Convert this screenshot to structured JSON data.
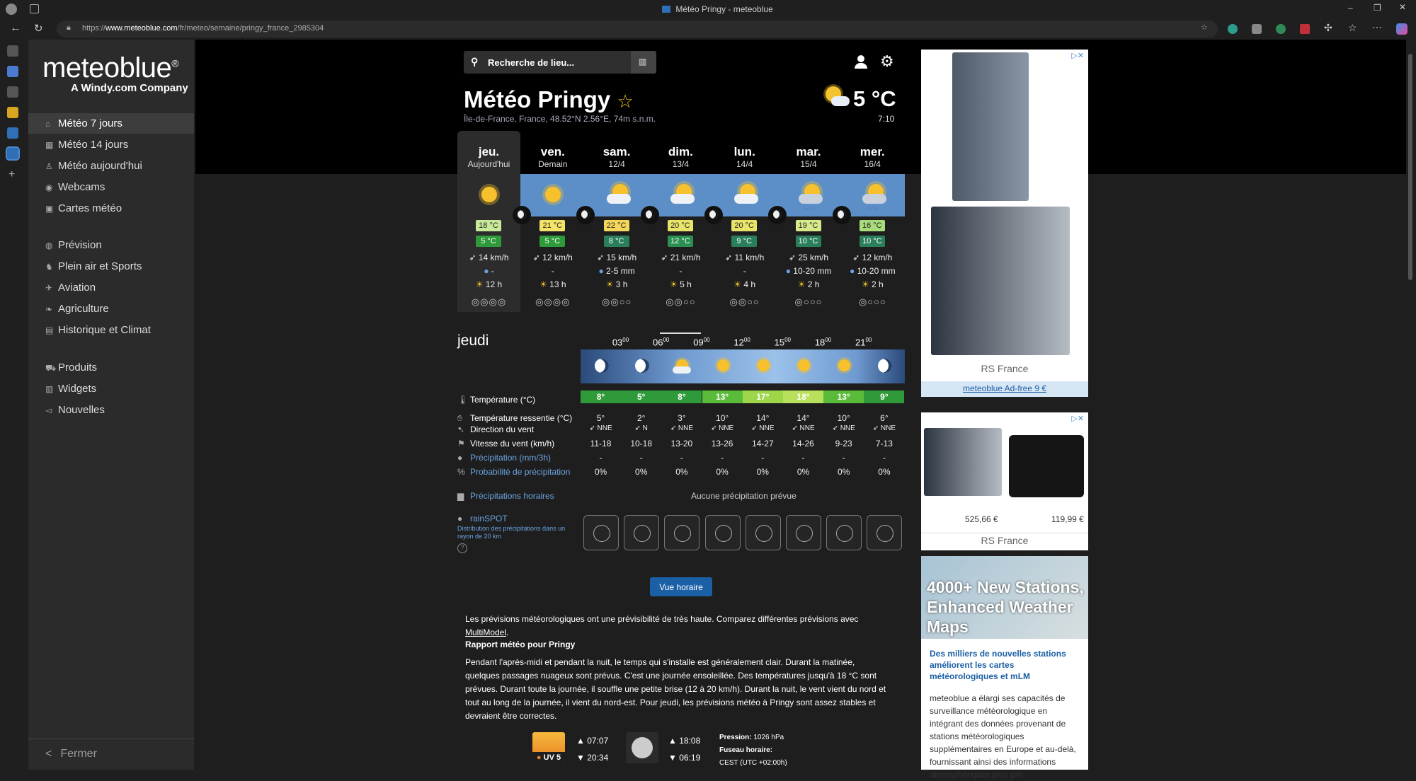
{
  "browser": {
    "tab_title": "Météo Pringy - meteoblue",
    "url_prefix": "https://",
    "url_host": "www.meteoblue.com",
    "url_path": "/fr/meteo/semaine/pringy_france_2985304"
  },
  "sidebar": {
    "logo": "meteoblue",
    "logo_sub": "A Windy.com Company",
    "items": [
      {
        "label": "Météo 7 jours",
        "icon": "home-icon"
      },
      {
        "label": "Météo 14 jours",
        "icon": "calendar-icon"
      },
      {
        "label": "Météo aujourd'hui",
        "icon": "person-icon"
      },
      {
        "label": "Webcams",
        "icon": "webcam-icon"
      },
      {
        "label": "Cartes météo",
        "icon": "map-icon"
      },
      {
        "label": "Prévision",
        "icon": "globe-icon"
      },
      {
        "label": "Plein air et Sports",
        "icon": "hiker-icon"
      },
      {
        "label": "Aviation",
        "icon": "plane-icon"
      },
      {
        "label": "Agriculture",
        "icon": "leaf-icon"
      },
      {
        "label": "Historique et Climat",
        "icon": "chart-icon"
      },
      {
        "label": "Produits",
        "icon": "cart-icon"
      },
      {
        "label": "Widgets",
        "icon": "widget-icon"
      },
      {
        "label": "Nouvelles",
        "icon": "megaphone-icon"
      }
    ],
    "close_label": "Fermer"
  },
  "search": {
    "placeholder": "Recherche de lieu..."
  },
  "header": {
    "city": "Météo Pringy",
    "coords": "Île-de-France, France, 48.52°N 2.56°E, 74m s.n.m.",
    "current_temp": "5 °C",
    "current_time": "7:10"
  },
  "days": [
    {
      "name": "jeu.",
      "date": "Aujourd'hui",
      "tmax": "18 °C",
      "tmin": "5 °C",
      "wind": "14 km/h",
      "prec": "-",
      "sun": "12 h",
      "pred": "◎◎◎◎",
      "icon": "sunny-icon",
      "tmax_color": "#c8e89a",
      "tmin_color": "#2f9a3a"
    },
    {
      "name": "ven.",
      "date": "Demain",
      "tmax": "21 °C",
      "tmin": "5 °C",
      "wind": "12 km/h",
      "prec": "-",
      "sun": "13 h",
      "pred": "◎◎◎◎",
      "icon": "sunny-icon",
      "tmax_color": "#f3e467",
      "tmin_color": "#2f9a3a"
    },
    {
      "name": "sam.",
      "date": "12/4",
      "tmax": "22 °C",
      "tmin": "8 °C",
      "wind": "15 km/h",
      "prec": "2-5 mm",
      "sun": "3 h",
      "pred": "◎◎○○",
      "icon": "partly-cloudy-icon",
      "tmax_color": "#f3d65a",
      "tmin_color": "#2a7f5a"
    },
    {
      "name": "dim.",
      "date": "13/4",
      "tmax": "20 °C",
      "tmin": "12 °C",
      "wind": "21 km/h",
      "prec": "-",
      "sun": "5 h",
      "pred": "◎◎○○",
      "icon": "partly-cloudy-icon",
      "tmax_color": "#e8e46a",
      "tmin_color": "#2a8f50"
    },
    {
      "name": "lun.",
      "date": "14/4",
      "tmax": "20 °C",
      "tmin": "9 °C",
      "wind": "11 km/h",
      "prec": "-",
      "sun": "4 h",
      "pred": "◎◎○○",
      "icon": "partly-cloudy-icon",
      "tmax_color": "#e8e46a",
      "tmin_color": "#2a7f5a"
    },
    {
      "name": "mar.",
      "date": "15/4",
      "tmax": "19 °C",
      "tmin": "10 °C",
      "wind": "25 km/h",
      "prec": "10-20 mm",
      "sun": "2 h",
      "pred": "◎○○○",
      "icon": "rain-cloud-icon",
      "tmax_color": "#d6ea8a",
      "tmin_color": "#2a7f5a"
    },
    {
      "name": "mer.",
      "date": "16/4",
      "tmax": "16 °C",
      "tmin": "10 °C",
      "wind": "12 km/h",
      "prec": "10-20 mm",
      "sun": "2 h",
      "pred": "◎○○○",
      "icon": "rain-cloud-icon",
      "tmax_color": "#a8dc7a",
      "tmin_color": "#2a7f5a"
    }
  ],
  "hourly": {
    "title": "jeudi",
    "hours": [
      "03",
      "06",
      "09",
      "12",
      "15",
      "18",
      "21"
    ],
    "labels": {
      "temp": "Température (°C)",
      "feel": "Température ressentie (°C)",
      "dir": "Direction du vent",
      "speed": "Vitesse du vent (km/h)",
      "prec": "Précipitation (mm/3h)",
      "prob": "Probabilité de précipitation",
      "hourly_prec": "Précipitations horaires",
      "rainspot": "rainSPOT",
      "rainspot_desc": "Distribution des précipitations dans un rayon de 20 km"
    },
    "temp": [
      "8°",
      "5°",
      "8°",
      "13°",
      "17°",
      "18°",
      "13°",
      "9°"
    ],
    "temp_colors": [
      "#2f9a3a",
      "#2f9a3a",
      "#2f9a3a",
      "#5aba3a",
      "#9ed64a",
      "#b9e05a",
      "#5aba3a",
      "#2f9a3a"
    ],
    "feel": [
      "5°",
      "2°",
      "3°",
      "10°",
      "14°",
      "14°",
      "10°",
      "6°"
    ],
    "dir": [
      "NNE",
      "N",
      "NNE",
      "NNE",
      "NNE",
      "NNE",
      "NNE",
      "NNE"
    ],
    "speed": [
      "11-18",
      "10-18",
      "13-20",
      "13-26",
      "14-27",
      "14-26",
      "9-23",
      "7-13"
    ],
    "prec": [
      "-",
      "-",
      "-",
      "-",
      "-",
      "-",
      "-",
      "-"
    ],
    "prob": [
      "0%",
      "0%",
      "0%",
      "0%",
      "0%",
      "0%",
      "0%",
      "0%"
    ],
    "no_prec": "Aucune précipitation prévue",
    "button": "Vue horaire"
  },
  "text": {
    "predict": "Les prévisions météorologiques ont une prévisibilité de très haute. Comparez différentes prévisions avec ",
    "multimodel": "MultiModel",
    "report_title": "Rapport météo pour Pringy",
    "report": "Pendant l'après-midi et pendant la nuit, le temps qui s'installe est généralement clair. Durant la matinée, quelques passages nuageux sont prévus. C'est une journée ensoleillée. Des températures jusqu'à 18 °C sont prévues. Durant toute la journée, il souffle une petite brise (12 à 20 km/h). Durant la nuit, le vent vient du nord et tout au long de la journée, il vient du nord-est. Pour jeudi, les prévisions météo à Pringy sont assez stables et devraient être correctes."
  },
  "astro": {
    "uv": "UV 5",
    "sunrise": "07:07",
    "sunset": "20:34",
    "moonrise": "18:08",
    "moonset": "06:19",
    "pressure_label": "Pression:",
    "pressure": "1026 hPa",
    "tz_label": "Fuseau horaire:",
    "tz": "CEST (UTC +02:00h)"
  },
  "ads": {
    "ad1_brand": "RS France",
    "adfree": "meteoblue Ad-free 9 €",
    "price1": "525,66 €",
    "price2": "119,99 €",
    "ad2_brand": "RS France",
    "ad3_banner": "4000+ New Stations, Enhanced Weather Maps",
    "ad3_title": "Des milliers de nouvelles stations améliorent les cartes météorologiques et mLM",
    "ad3_text": "meteoblue a élargi ses capacités de surveillance météorologique en intégrant des données provenant de stations météorologiques supplémentaires en Europe et au-delà, fournissant ainsi des informations atmosphériques plus pré-"
  }
}
